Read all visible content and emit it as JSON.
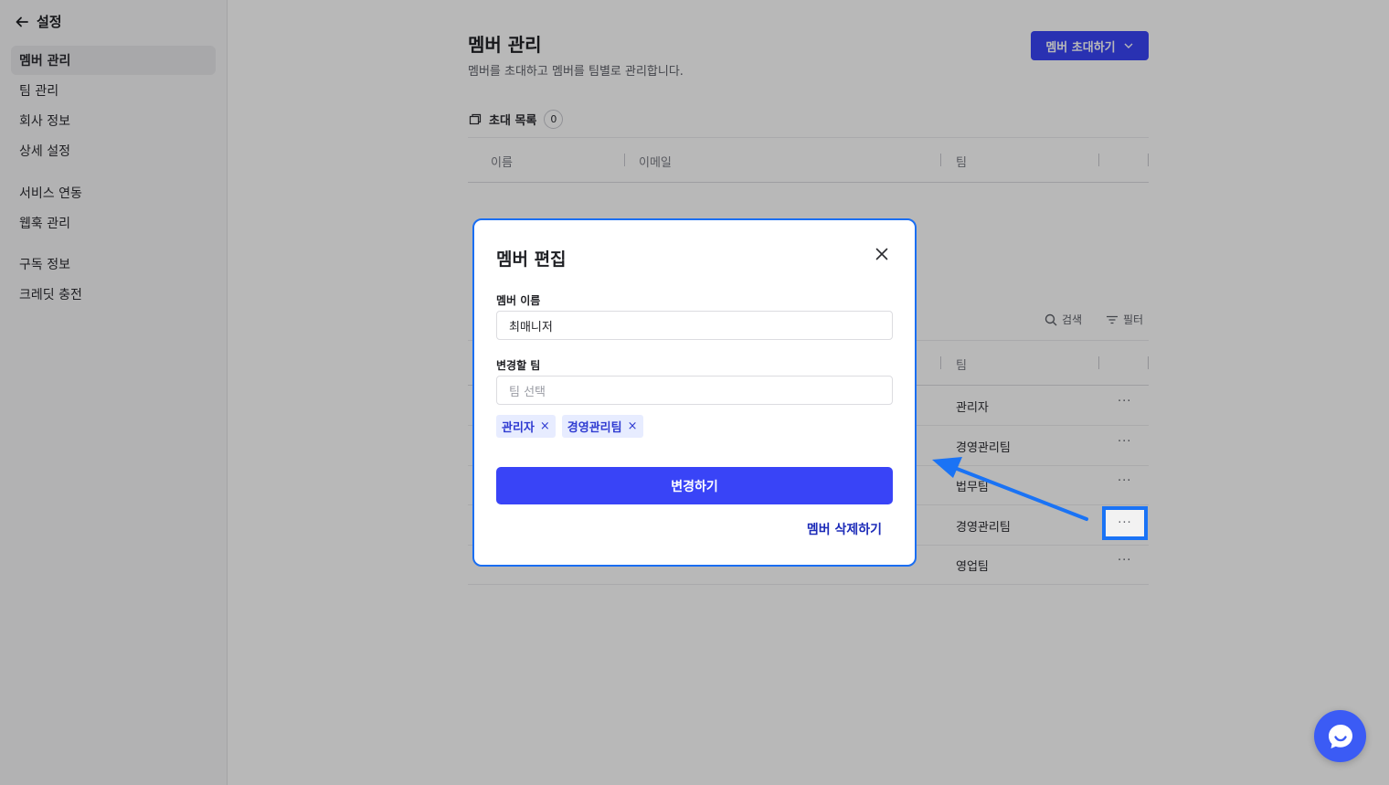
{
  "sidebar": {
    "back_label": "설정",
    "items": [
      {
        "label": "멤버 관리",
        "active": true
      },
      {
        "label": "팀 관리"
      },
      {
        "label": "회사 정보"
      },
      {
        "label": "상세 설정"
      },
      {
        "label": "서비스 연동"
      },
      {
        "label": "웹훅 관리"
      },
      {
        "label": "구독 정보"
      },
      {
        "label": "크레딧 충전"
      }
    ]
  },
  "page": {
    "title": "멤버 관리",
    "subtitle": "멤버를 초대하고 멤버를 팀별로 관리합니다.",
    "invite_button": "멤버 초대하기"
  },
  "invites": {
    "title": "초대 목록",
    "count": "0",
    "columns": [
      "이름",
      "이메일",
      "팀"
    ]
  },
  "members": {
    "search_label": "검색",
    "filter_label": "필터",
    "columns": [
      "팀"
    ],
    "rows": [
      {
        "name": "",
        "email": "",
        "team": "관리자"
      },
      {
        "name": "",
        "email": "",
        "team": "경영관리팀"
      },
      {
        "name": "",
        "email": "",
        "team": "법무팀"
      },
      {
        "name": "",
        "email": "",
        "team": "경영관리팀"
      },
      {
        "name": "",
        "email": "",
        "team": "영업팀"
      }
    ],
    "more_glyph": "···"
  },
  "modal": {
    "title": "멤버 편집",
    "name_label": "멤버 이름",
    "name_value": "최매니저",
    "team_label": "변경할 팀",
    "team_placeholder": "팀 선택",
    "chips": [
      "관리자",
      "경영관리팀"
    ],
    "chip_remove_glyph": "×",
    "submit_label": "변경하기",
    "delete_label": "멤버 삭제하기"
  },
  "colors": {
    "primary": "#3944f7",
    "annotation": "#1a73f5",
    "chip_bg": "#e7ecff",
    "chip_text": "#2f3bd1"
  }
}
